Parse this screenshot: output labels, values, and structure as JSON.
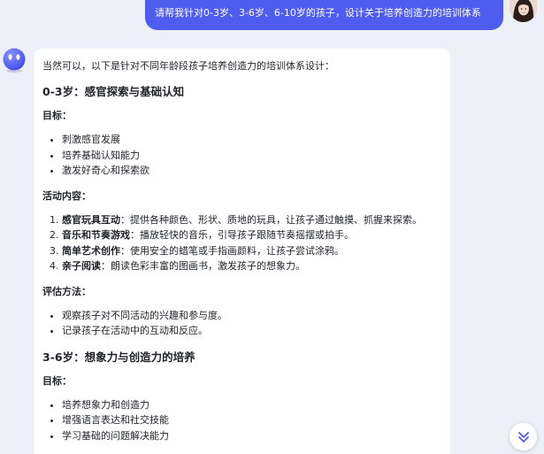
{
  "user_message": "请帮我针对0-3岁、3-6岁、6-10岁的孩子，设计关于培养创造力的培训体系",
  "answer": {
    "intro": "当然可以，以下是针对不同年龄段孩子培养创造力的培训体系设计：",
    "section1": {
      "heading": "0-3岁：感官探索与基础认知",
      "goals_label": "目标：",
      "goals": [
        "刺激感官发展",
        "培养基础认知能力",
        "激发好奇心和探索欲"
      ],
      "activities_label": "活动内容：",
      "activities": [
        {
          "term": "感官玩具互动",
          "text": "：提供各种颜色、形状、质地的玩具，让孩子通过触摸、抓握来探索。"
        },
        {
          "term": "音乐和节奏游戏",
          "text": "：播放轻快的音乐，引导孩子跟随节奏摇摆或拍手。"
        },
        {
          "term": "简单艺术创作",
          "text": "：使用安全的蜡笔或手指画颜料，让孩子尝试涂鸦。"
        },
        {
          "term": "亲子阅读",
          "text": "：朗读色彩丰富的图画书，激发孩子的想象力。"
        }
      ],
      "eval_label": "评估方法：",
      "evals": [
        "观察孩子对不同活动的兴趣和参与度。",
        "记录孩子在活动中的互动和反应。"
      ]
    },
    "section2": {
      "heading": "3-6岁：想象力与创造力的培养",
      "goals_label": "目标：",
      "goals": [
        "培养想象力和创造力",
        "增强语言表达和社交技能",
        "学习基础的问题解决能力"
      ]
    }
  },
  "icons": {
    "bot_avatar": "robot-face-icon",
    "user_avatar": "user-photo",
    "scroll": "double-chevron-down-icon"
  },
  "colors": {
    "user_bubble": "#4f5cf0",
    "accent": "#4f5cf0"
  }
}
